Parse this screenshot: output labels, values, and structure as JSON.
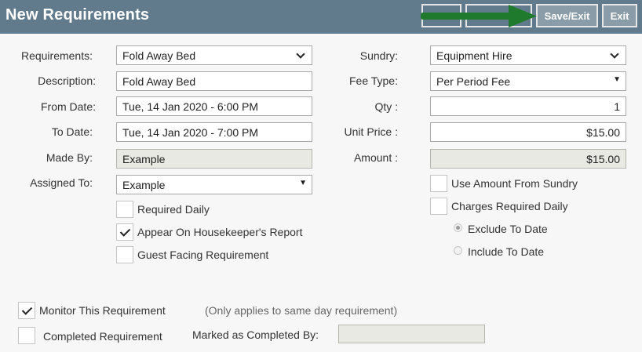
{
  "header": {
    "title": "New Requirements",
    "save_exit_label": "Save/Exit",
    "exit_label": "Exit"
  },
  "left": {
    "requirements": {
      "label": "Requirements:",
      "value": "Fold Away Bed"
    },
    "description": {
      "label": "Description:",
      "value": "Fold Away Bed"
    },
    "from_date": {
      "label": "From Date:",
      "value": "Tue, 14 Jan 2020 - 6:00 PM"
    },
    "to_date": {
      "label": "To Date:",
      "value": "Tue, 14 Jan 2020 - 7:00 PM"
    },
    "made_by": {
      "label": "Made By:",
      "value": "Example"
    },
    "assigned_to": {
      "label": "Assigned To:",
      "value": "Example"
    },
    "required_daily": {
      "label": "Required Daily",
      "checked": false
    },
    "appear_housekeeper": {
      "label": "Appear On Housekeeper's Report",
      "checked": true
    },
    "guest_facing": {
      "label": "Guest Facing Requirement",
      "checked": false
    }
  },
  "right": {
    "sundry": {
      "label": "Sundry:",
      "value": "Equipment Hire"
    },
    "fee_type": {
      "label": "Fee Type:",
      "value": "Per Period Fee"
    },
    "qty": {
      "label": "Qty :",
      "value": "1"
    },
    "unit_price": {
      "label": "Unit Price :",
      "value": "$15.00"
    },
    "amount": {
      "label": "Amount :",
      "value": "$15.00"
    },
    "use_amount_from_sundry": {
      "label": "Use Amount From Sundry",
      "checked": false
    },
    "charges_required_daily": {
      "label": "Charges Required Daily",
      "checked": false
    },
    "exclude_to_date": {
      "label": "Exclude To Date",
      "selected": true
    },
    "include_to_date": {
      "label": "Include To Date",
      "selected": false
    }
  },
  "bottom": {
    "monitor": {
      "label": "Monitor This Requirement",
      "checked": true
    },
    "monitor_note": "(Only applies to same day requirement)",
    "completed": {
      "label": "Completed Requirement",
      "checked": false
    },
    "marked_completed_by": {
      "label": "Marked as Completed By:",
      "value": ""
    }
  },
  "colors": {
    "header_bg": "#627b8c",
    "arrow": "#1f7a2e"
  }
}
